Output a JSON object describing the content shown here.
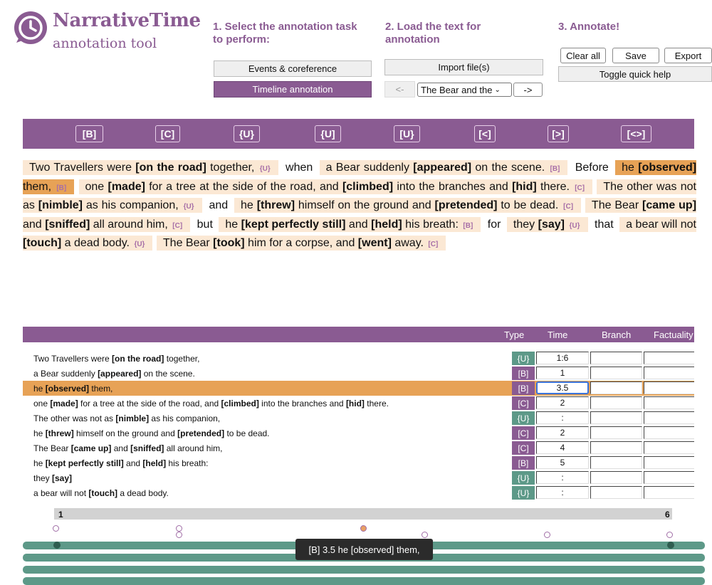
{
  "header": {
    "title": "NarrativeTime",
    "subtitle": "annotation tool",
    "step1": "1. Select the annotation task to perform:",
    "step2": "2. Load the text for annotation",
    "step3": "3. Annotate!"
  },
  "tasks": {
    "events": "Events & coreference",
    "timeline": "Timeline annotation"
  },
  "loader": {
    "import": "Import file(s)",
    "prev": "<-",
    "next": "->",
    "selected_file": "The Bear and the"
  },
  "actions": {
    "clear": "Clear all",
    "save": "Save",
    "export": "Export",
    "help": "Toggle quick help"
  },
  "filters": [
    "[B]",
    "[C]",
    "{U}",
    "{U]",
    "[U}",
    "[<]",
    "[>]",
    "[<>]"
  ],
  "narrative": [
    {
      "pre": "Two Travellers were ",
      "ev": "[on the road]",
      "post": " together,",
      "tag": "{U}"
    },
    {
      "plain": "when"
    },
    {
      "pre": "a Bear suddenly ",
      "ev": "[appeared]",
      "post": " on the scene.",
      "tag": "[B]"
    },
    {
      "plain": "Before"
    },
    {
      "pre": "he ",
      "ev": "[observed]",
      "post": " them,",
      "tag": "[B]"
    },
    {
      "pre": "one ",
      "ev": "[made]",
      "mid": " for a tree at the side of the road, and ",
      "ev2": "[climbed]",
      "mid2": " into the branches and ",
      "ev3": "[hid]",
      "post": " there.",
      "tag": "[C]"
    },
    {
      "pre": "The other was not as ",
      "ev": "[nimble]",
      "post": " as his companion,",
      "tag": "{U}"
    },
    {
      "plain": "and"
    },
    {
      "pre": "he ",
      "ev": "[threw]",
      "mid": " himself on the ground and ",
      "ev2": "[pretended]",
      "post": " to be dead.",
      "tag": "[C]"
    },
    {
      "pre": "The Bear ",
      "ev": "[came up]",
      "mid": " and ",
      "ev2": "[sniffed]",
      "post": " all around him,",
      "tag": "[C]"
    },
    {
      "plain": "but"
    },
    {
      "pre": "he ",
      "ev": "[kept perfectly still]",
      "mid": " and ",
      "ev2": "[held]",
      "post": " his breath:",
      "tag": "[B]"
    },
    {
      "plain": "for"
    },
    {
      "pre": "they ",
      "ev": "[say]",
      "post": "",
      "tag": "{U}"
    },
    {
      "plain": "that"
    },
    {
      "pre": "a bear will not ",
      "ev": "[touch]",
      "post": " a dead body.",
      "tag": "{U}"
    },
    {
      "pre": "The Bear ",
      "ev": "[took]",
      "mid": " him for a corpse, and ",
      "ev2": "[went]",
      "post": " away.",
      "tag": "[C]"
    }
  ],
  "table": {
    "columns": {
      "type": "Type",
      "time": "Time",
      "branch": "Branch",
      "factuality": "Factuality"
    },
    "rows": [
      {
        "pre": "Two Travellers were ",
        "ev": "[on the road]",
        "post": " together,",
        "type": "{U}",
        "time": "1:6"
      },
      {
        "pre": "a Bear suddenly ",
        "ev": "[appeared]",
        "post": " on the scene.",
        "type": "[B]",
        "time": "1"
      },
      {
        "pre": "he ",
        "ev": "[observed]",
        "post": " them,",
        "type": "[B]",
        "time": "3.5"
      },
      {
        "pre": "one ",
        "ev": "[made]",
        "mid": " for a tree at the side of the road, and ",
        "ev2": "[climbed]",
        "mid2": " into the branches and ",
        "ev3": "[hid]",
        "post": " there.",
        "type": "[C]",
        "time": "2"
      },
      {
        "pre": "The other was not as ",
        "ev": "[nimble]",
        "post": " as his companion,",
        "type": "{U}",
        "time": ":"
      },
      {
        "pre": "he ",
        "ev": "[threw]",
        "mid": " himself on the ground and ",
        "ev2": "[pretended]",
        "post": " to be dead.",
        "type": "[C]",
        "time": "2"
      },
      {
        "pre": "The Bear ",
        "ev": "[came up]",
        "mid": " and ",
        "ev2": "[sniffed]",
        "post": " all around him,",
        "type": "[C]",
        "time": "4"
      },
      {
        "pre": "he ",
        "ev": "[kept perfectly still]",
        "mid": " and ",
        "ev2": "[held]",
        "post": " his breath:",
        "type": "[B]",
        "time": "5"
      },
      {
        "pre": "they ",
        "ev": "[say]",
        "post": "",
        "type": "{U}",
        "time": ":"
      },
      {
        "pre": "a bear will not ",
        "ev": "[touch]",
        "post": " a dead body.",
        "type": "{U}",
        "time": ":"
      }
    ]
  },
  "timeline": {
    "start": "1",
    "end": "6",
    "tooltip": "[B] 3.5 he [observed] them,"
  },
  "colors": {
    "brand": "#8a5b92",
    "event_bg": "#fbe8d4",
    "highlight": "#e7a256",
    "unknown": "#5d9988",
    "link": "#3b74d9"
  }
}
